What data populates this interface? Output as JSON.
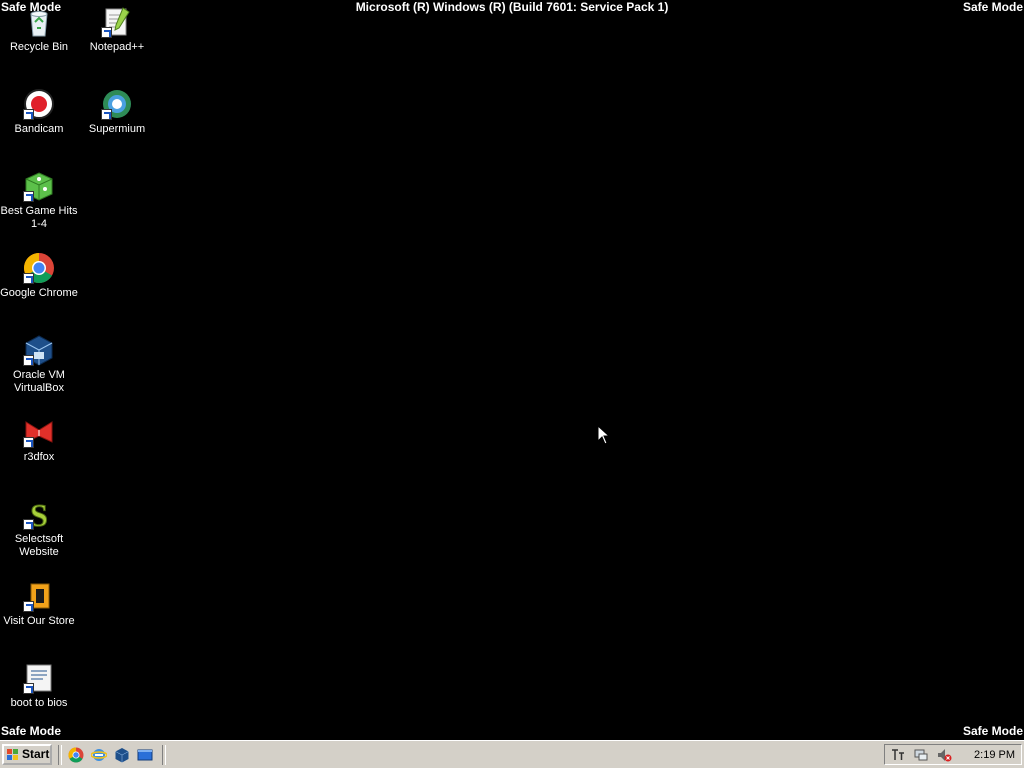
{
  "desktop": {
    "safe_mode_label": "Safe Mode",
    "build_label": "Microsoft (R) Windows (R) (Build 7601: Service Pack 1)",
    "background_color": "#000000",
    "icons": [
      {
        "label": "Recycle Bin",
        "icon": "recycle-bin-icon"
      },
      {
        "label": "Notepad++",
        "icon": "notepad-plus-plus-icon"
      },
      {
        "label": "Bandicam",
        "icon": "bandicam-icon"
      },
      {
        "label": "Supermium",
        "icon": "supermium-icon"
      },
      {
        "label": "Best Game Hits 1-4",
        "icon": "game-cube-icon"
      },
      {
        "label": "Google Chrome",
        "icon": "chrome-icon"
      },
      {
        "label": "Oracle VM VirtualBox",
        "icon": "virtualbox-icon"
      },
      {
        "label": "r3dfox",
        "icon": "r3dfox-icon"
      },
      {
        "label": "Selectsoft Website",
        "icon": "selectsoft-icon"
      },
      {
        "label": "Visit Our Store",
        "icon": "store-icon"
      },
      {
        "label": "boot to bios",
        "icon": "document-icon"
      }
    ]
  },
  "taskbar": {
    "start_label": "Start",
    "quick_launch": [
      "chrome-icon",
      "internet-explorer-icon",
      "virtualbox-icon",
      "show-desktop-icon"
    ],
    "tray_icons": [
      "input-method-icon",
      "network-icon",
      "volume-muted-icon"
    ],
    "clock": "2:19 PM"
  }
}
